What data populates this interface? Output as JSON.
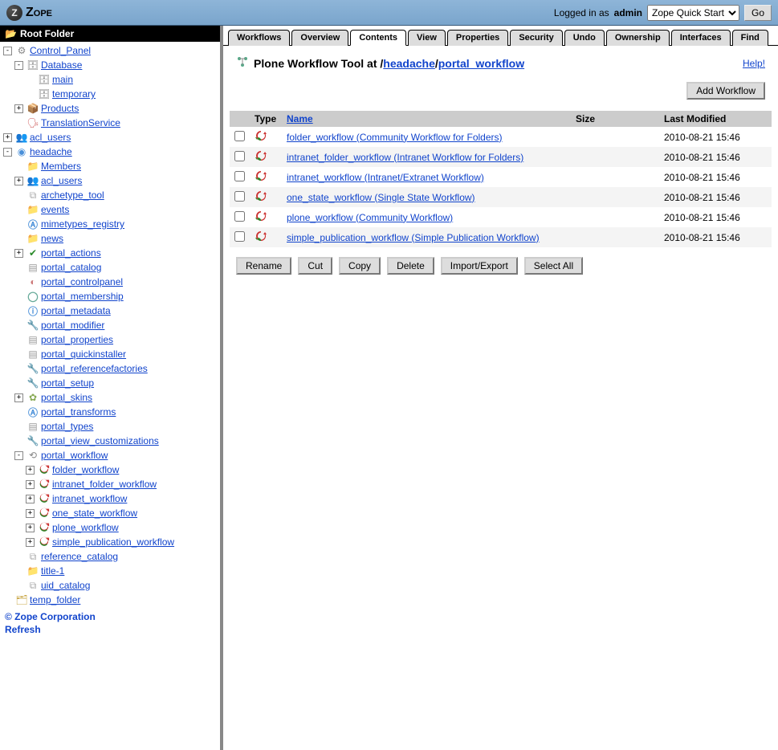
{
  "header": {
    "brand": "Zope",
    "logged_in_text": "Logged in as",
    "user": "admin",
    "select_value": "Zope Quick Start",
    "go_label": "Go"
  },
  "sidebar": {
    "root_label": "Root Folder",
    "tree": [
      {
        "indent": 0,
        "toggle": "-",
        "icon": "control",
        "label": "Control_Panel"
      },
      {
        "indent": 1,
        "toggle": "-",
        "icon": "db",
        "label": "Database"
      },
      {
        "indent": 2,
        "toggle": "",
        "icon": "db",
        "label": "main"
      },
      {
        "indent": 2,
        "toggle": "",
        "icon": "db",
        "label": "temporary"
      },
      {
        "indent": 1,
        "toggle": "+",
        "icon": "products",
        "label": "Products"
      },
      {
        "indent": 1,
        "toggle": "",
        "icon": "trans",
        "label": "TranslationService"
      },
      {
        "indent": 0,
        "toggle": "+",
        "icon": "acl",
        "label": "acl_users"
      },
      {
        "indent": 0,
        "toggle": "-",
        "icon": "plone",
        "label": "headache"
      },
      {
        "indent": 1,
        "toggle": "",
        "icon": "folder",
        "label": "Members"
      },
      {
        "indent": 1,
        "toggle": "+",
        "icon": "acl",
        "label": "acl_users"
      },
      {
        "indent": 1,
        "toggle": "",
        "icon": "columns",
        "label": "archetype_tool"
      },
      {
        "indent": 1,
        "toggle": "",
        "icon": "folder",
        "label": "events"
      },
      {
        "indent": 1,
        "toggle": "",
        "icon": "circlea",
        "label": "mimetypes_registry"
      },
      {
        "indent": 1,
        "toggle": "",
        "icon": "folder",
        "label": "news"
      },
      {
        "indent": 1,
        "toggle": "+",
        "icon": "green",
        "label": "portal_actions"
      },
      {
        "indent": 1,
        "toggle": "",
        "icon": "doc",
        "label": "portal_catalog"
      },
      {
        "indent": 1,
        "toggle": "",
        "icon": "circlec",
        "label": "portal_controlpanel"
      },
      {
        "indent": 1,
        "toggle": "",
        "icon": "circleo",
        "label": "portal_membership"
      },
      {
        "indent": 1,
        "toggle": "",
        "icon": "circlei",
        "label": "portal_metadata"
      },
      {
        "indent": 1,
        "toggle": "",
        "icon": "wrench",
        "label": "portal_modifier"
      },
      {
        "indent": 1,
        "toggle": "",
        "icon": "doc",
        "label": "portal_properties"
      },
      {
        "indent": 1,
        "toggle": "",
        "icon": "doc",
        "label": "portal_quickinstaller"
      },
      {
        "indent": 1,
        "toggle": "",
        "icon": "wrench",
        "label": "portal_referencefactories"
      },
      {
        "indent": 1,
        "toggle": "",
        "icon": "wrench",
        "label": "portal_setup"
      },
      {
        "indent": 1,
        "toggle": "+",
        "icon": "skins",
        "label": "portal_skins"
      },
      {
        "indent": 1,
        "toggle": "",
        "icon": "circlea",
        "label": "portal_transforms"
      },
      {
        "indent": 1,
        "toggle": "",
        "icon": "doc",
        "label": "portal_types"
      },
      {
        "indent": 1,
        "toggle": "",
        "icon": "wrench",
        "label": "portal_view_customizations"
      },
      {
        "indent": 1,
        "toggle": "-",
        "icon": "workflow",
        "label": "portal_workflow"
      },
      {
        "indent": 2,
        "toggle": "+",
        "icon": "refresh",
        "label": "folder_workflow"
      },
      {
        "indent": 2,
        "toggle": "+",
        "icon": "refresh",
        "label": "intranet_folder_workflow"
      },
      {
        "indent": 2,
        "toggle": "+",
        "icon": "refresh",
        "label": "intranet_workflow"
      },
      {
        "indent": 2,
        "toggle": "+",
        "icon": "refresh",
        "label": "one_state_workflow"
      },
      {
        "indent": 2,
        "toggle": "+",
        "icon": "refresh",
        "label": "plone_workflow"
      },
      {
        "indent": 2,
        "toggle": "+",
        "icon": "refresh",
        "label": "simple_publication_workflow"
      },
      {
        "indent": 1,
        "toggle": "",
        "icon": "columns",
        "label": "reference_catalog"
      },
      {
        "indent": 1,
        "toggle": "",
        "icon": "folder",
        "label": "title-1"
      },
      {
        "indent": 1,
        "toggle": "",
        "icon": "columns",
        "label": "uid_catalog"
      },
      {
        "indent": 0,
        "toggle": "",
        "icon": "temp",
        "label": "temp_folder"
      }
    ],
    "footer_corp": "© Zope Corporation",
    "footer_refresh": "Refresh"
  },
  "tabs": [
    {
      "label": "Workflows",
      "active": false
    },
    {
      "label": "Overview",
      "active": false
    },
    {
      "label": "Contents",
      "active": true
    },
    {
      "label": "View",
      "active": false
    },
    {
      "label": "Properties",
      "active": false
    },
    {
      "label": "Security",
      "active": false
    },
    {
      "label": "Undo",
      "active": false
    },
    {
      "label": "Ownership",
      "active": false
    },
    {
      "label": "Interfaces",
      "active": false
    },
    {
      "label": "Find",
      "active": false
    }
  ],
  "page": {
    "tool_title": "Plone Workflow Tool at",
    "path_prefix": " /",
    "path_site": "headache",
    "path_sep": "/",
    "path_tool": "portal_workflow",
    "help_label": "Help!",
    "add_button": "Add Workflow"
  },
  "columns": {
    "type": "Type",
    "name": "Name",
    "size": "Size",
    "modified": "Last Modified"
  },
  "rows": [
    {
      "name": "folder_workflow (Community Workflow for Folders)",
      "size": "",
      "modified": "2010-08-21 15:46"
    },
    {
      "name": "intranet_folder_workflow (Intranet Workflow for Folders)",
      "size": "",
      "modified": "2010-08-21 15:46"
    },
    {
      "name": "intranet_workflow (Intranet/Extranet Workflow)",
      "size": "",
      "modified": "2010-08-21 15:46"
    },
    {
      "name": "one_state_workflow (Single State Workflow)",
      "size": "",
      "modified": "2010-08-21 15:46"
    },
    {
      "name": "plone_workflow (Community Workflow)",
      "size": "",
      "modified": "2010-08-21 15:46"
    },
    {
      "name": "simple_publication_workflow (Simple Publication Workflow)",
      "size": "",
      "modified": "2010-08-21 15:46"
    }
  ],
  "buttons": {
    "rename": "Rename",
    "cut": "Cut",
    "copy": "Copy",
    "delete": "Delete",
    "import_export": "Import/Export",
    "select_all": "Select All"
  }
}
